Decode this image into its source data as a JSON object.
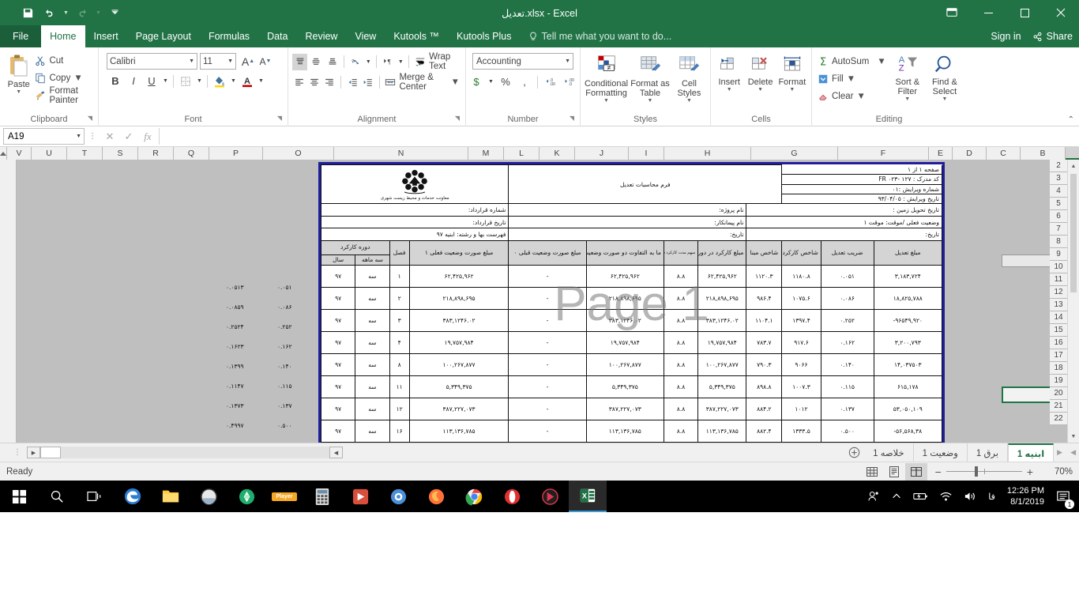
{
  "window": {
    "title": "تعدیل.xlsx - Excel",
    "quick_access": [
      "save-icon",
      "undo-icon",
      "redo-icon",
      "customize-icon"
    ],
    "buttons": [
      "ribbon-display-icon",
      "minimize-icon",
      "restore-icon",
      "close-icon"
    ]
  },
  "ribbon": {
    "tabs": [
      "File",
      "Home",
      "Insert",
      "Page Layout",
      "Formulas",
      "Data",
      "Review",
      "View",
      "Kutools ™",
      "Kutools Plus"
    ],
    "active_tab": "Home",
    "tellme": "Tell me what you want to do...",
    "signin": "Sign in",
    "share": "Share",
    "groups": {
      "clipboard": {
        "label": "Clipboard",
        "paste": "Paste",
        "cut": "Cut",
        "copy": "Copy",
        "format_painter": "Format Painter"
      },
      "font": {
        "label": "Font",
        "font_name": "Calibri",
        "font_size": "11",
        "bold": "B",
        "italic": "I",
        "underline": "U"
      },
      "alignment": {
        "label": "Alignment",
        "wrap_text": "Wrap Text",
        "merge_center": "Merge & Center"
      },
      "number": {
        "label": "Number",
        "format": "Accounting",
        "currency": "$",
        "percent": "%",
        "comma": ",",
        "inc_dec": ".00",
        "dec_dec": ".00"
      },
      "styles": {
        "label": "Styles",
        "conditional": "Conditional Formatting",
        "format_as_table": "Format as Table",
        "cell_styles": "Cell Styles"
      },
      "cells": {
        "label": "Cells",
        "insert": "Insert",
        "delete": "Delete",
        "format": "Format"
      },
      "editing": {
        "label": "Editing",
        "autosum": "AutoSum",
        "fill": "Fill",
        "clear": "Clear",
        "sort_filter": "Sort & Filter",
        "find_select": "Find & Select"
      }
    }
  },
  "formula_bar": {
    "name_box": "A19",
    "formula": "",
    "cancel": "✕",
    "enter": "✓",
    "fx": "fx"
  },
  "grid": {
    "columns": [
      "V",
      "U",
      "T",
      "S",
      "R",
      "Q",
      "P",
      "O",
      "N",
      "M",
      "L",
      "K",
      "J",
      "I",
      "H",
      "G",
      "F",
      "E",
      "D",
      "C",
      "B",
      "A"
    ],
    "selected_column": "A",
    "rows": [
      "2",
      "3",
      "4",
      "5",
      "6",
      "7",
      "8",
      "9",
      "10",
      "11",
      "12",
      "13",
      "14",
      "15",
      "16",
      "17",
      "18",
      "19",
      "20",
      "21",
      "22"
    ],
    "selected_cell": "A19"
  },
  "document": {
    "header": {
      "page_of": "صفحه ۱ از ۱",
      "doc_code": "کد مدرک : ۱۲۷ -۰۲۳ FR",
      "revision_no": "شماره ویرایش :۰۱",
      "revision_date": "تاریخ ویرایش : ۹۳/۰۴/۰۵",
      "form_title": "فرم محاسبات تعدیل",
      "logo_caption": "معاونت خدمات و محیط زیست شهری"
    },
    "info_rows": [
      {
        "right": "شماره قرارداد:",
        "middle": "نام پروژه:",
        "left": "تاریخ تحویل زمین :"
      },
      {
        "right": "تاریخ قرارداد:",
        "middle": "نام پیمانکار:",
        "left": "وضعیت فعلی /موقت: موقت ۱"
      },
      {
        "right": "فهرست بها و رشته: ابنیه ۹۷",
        "middle": "تاریخ:",
        "left": "تاریخ:"
      }
    ],
    "table_headers": {
      "period_group": "دوره کارکرد",
      "year": "سال",
      "quarter": "سه ماهه",
      "season": "فصل",
      "current_statement": "مبلغ صورت وضعیت فعلی ۱",
      "previous_statement": "مبلغ صورت وضعیت قبلی ۰",
      "difference": "ما به التفاوت دو صورت وضعیت",
      "percent_share": "سهم مدت کارکرد در ضریب سه ماهه کارکرد",
      "work_amount": "مبلغ کارکرد در دوره",
      "base_index": "شاخص مبنا",
      "work_index": "شاخص کارکرد",
      "adj_coef": "ضریب تعدیل",
      "adj_amount": "مبلغ تعدیل"
    },
    "table_rows": [
      {
        "year": "۹۷",
        "quarter": "سه",
        "season": "۱",
        "current": "۶۲,۴۲۵,۹۶۲",
        "previous": "-",
        "difference": "۶۲,۴۲۵,۹۶۲",
        "share": "۸.۸",
        "work": "۶۲,۴۲۵,۹۶۲",
        "base_index": "۱۱۲۰.۳",
        "work_index": "۱۱۸۰.۸",
        "coef": "۰.۰۵۱",
        "amount": "۳,۱۸۳,۷۲۴",
        "outer1": "۰.۰۵۱",
        "outer2": "۰.۰۵۱۳"
      },
      {
        "year": "۹۷",
        "quarter": "سه",
        "season": "۲",
        "current": "۲۱۸,۸۹۸,۶۹۵",
        "previous": "-",
        "difference": "۲۱۸,۸۹۸,۶۹۵",
        "share": "۸.۸",
        "work": "۲۱۸,۸۹۸,۶۹۵",
        "base_index": "۹۸۶.۴",
        "work_index": "۱۰۷۵.۶",
        "coef": "۰.۰۸۶",
        "amount": "۱۸,۸۲۵,۷۸۸",
        "outer1": "۰.۰۸۶",
        "outer2": "۰.۰۸۵۹"
      },
      {
        "year": "۹۷",
        "quarter": "سه",
        "season": "۳",
        "current": "۳۸۳,۱۲۴۶.۰۲",
        "previous": "-",
        "difference": "۳۸۳,۱۲۴۶.۰۲",
        "share": "۸.۸",
        "work": "۳۸۳,۱۲۴۶.۰۲",
        "base_index": "۱۱۰۴.۱",
        "work_index": "۱۳۹۷.۴",
        "coef": "۰.۲۵۲",
        "amount": "۹۶۵۴۹,۹۲۰-",
        "outer1": "۰.۲۵۲",
        "outer2": "۰.۲۵۲۴"
      },
      {
        "year": "۹۷",
        "quarter": "سه",
        "season": "۴",
        "current": "۱۹,۷۵۷,۹۸۴",
        "previous": "-",
        "difference": "۱۹,۷۵۷,۹۸۴",
        "share": "۸.۸",
        "work": "۱۹,۷۵۷,۹۸۴",
        "base_index": "۷۸۳.۷",
        "work_index": "۹۱۷.۶",
        "coef": "۰.۱۶۲",
        "amount": "۳,۲۰۰,۷۹۳",
        "outer1": "۰.۱۶۲",
        "outer2": "۰.۱۶۲۳"
      },
      {
        "year": "۹۷",
        "quarter": "سه",
        "season": "۸",
        "current": "۱۰۰,۲۶۷,۸۷۷",
        "previous": "-",
        "difference": "۱۰۰,۲۶۷,۸۷۷",
        "share": "۸.۸",
        "work": "۱۰۰,۲۶۷,۸۷۷",
        "base_index": "۷۹۰.۳",
        "work_index": "۹۰۶۶",
        "coef": "۰.۱۴۰",
        "amount": "۱۴,۰۳۷۵۰۳",
        "outer1": "۰.۱۴۰",
        "outer2": "۰.۱۳۹۹"
      },
      {
        "year": "۹۷",
        "quarter": "سه",
        "season": "۱۱",
        "current": "۵,۳۴۹,۳۷۵",
        "previous": "-",
        "difference": "۵,۳۴۹,۳۷۵",
        "share": "۸.۸",
        "work": "۵,۳۴۹,۳۷۵",
        "base_index": "۸۹۸.۸",
        "work_index": "۱۰۰۷.۳",
        "coef": "۰.۱۱۵",
        "amount": "۶۱۵,۱۷۸",
        "outer1": "۰.۱۱۵",
        "outer2": "۰.۱۱۴۷"
      },
      {
        "year": "۹۷",
        "quarter": "سه",
        "season": "۱۲",
        "current": "۳۸۷,۲۲۷,۰۷۳",
        "previous": "-",
        "difference": "۳۸۷,۲۲۷,۰۷۳",
        "share": "۸.۸",
        "work": "۳۸۷,۲۲۷,۰۷۳",
        "base_index": "۸۸۴.۲",
        "work_index": "۱۰۱۲",
        "coef": "۰.۱۳۷",
        "amount": "۵۳,۰۵۰,۱۰۹",
        "outer1": "۰.۱۳۷",
        "outer2": "۰.۱۳۷۳"
      },
      {
        "year": "۹۷",
        "quarter": "سه",
        "season": "۱۶",
        "current": "۱۱۳,۱۳۶,۷۸۵",
        "previous": "-",
        "difference": "۱۱۳,۱۳۶,۷۸۵",
        "share": "۸.۸",
        "work": "۱۱۳,۱۳۶,۷۸۵",
        "base_index": "۸۸۲.۴",
        "work_index": "۱۳۳۳.۵",
        "coef": "۰.۵۰۰",
        "amount": "۵۶,۵۶۸,۳۸-",
        "outer1": "۰.۵۰۰",
        "outer2": "۰.۴۹۹۷"
      }
    ],
    "watermark": "Page 1"
  },
  "sheet_tabs": {
    "tabs": [
      "ابنیه 1",
      "برق 1",
      "وضعیت 1",
      "خلاصه 1"
    ],
    "active": "ابنیه 1",
    "add_label": "+"
  },
  "status_bar": {
    "state": "Ready",
    "views": [
      "normal-view-icon",
      "page-layout-icon",
      "page-break-preview-icon"
    ],
    "active_view": "page-break-preview-icon",
    "zoom_out": "−",
    "zoom_in": "+",
    "zoom": "70%"
  },
  "taskbar": {
    "items": [
      "start-icon",
      "search-icon",
      "task-view-icon",
      "edge-icon",
      "file-explorer-icon",
      "app6-icon",
      "app7-icon",
      "player-icon",
      "calculator-icon",
      "app10-icon",
      "app11-icon",
      "firefox-icon",
      "chrome-icon",
      "opera-icon",
      "app15-icon",
      "excel-icon"
    ],
    "active_item": "excel-icon",
    "tray": [
      "people-icon",
      "show-hidden-icon",
      "battery-icon",
      "wifi-icon",
      "volume-icon",
      "lang-icon"
    ],
    "language": "فا",
    "time": "12:26 PM",
    "date": "8/1/2019",
    "notifications": "1"
  },
  "colors": {
    "excel_green": "#217346",
    "accent_blue": "#1f1f9e",
    "header_gray": "#d4d4d4"
  }
}
